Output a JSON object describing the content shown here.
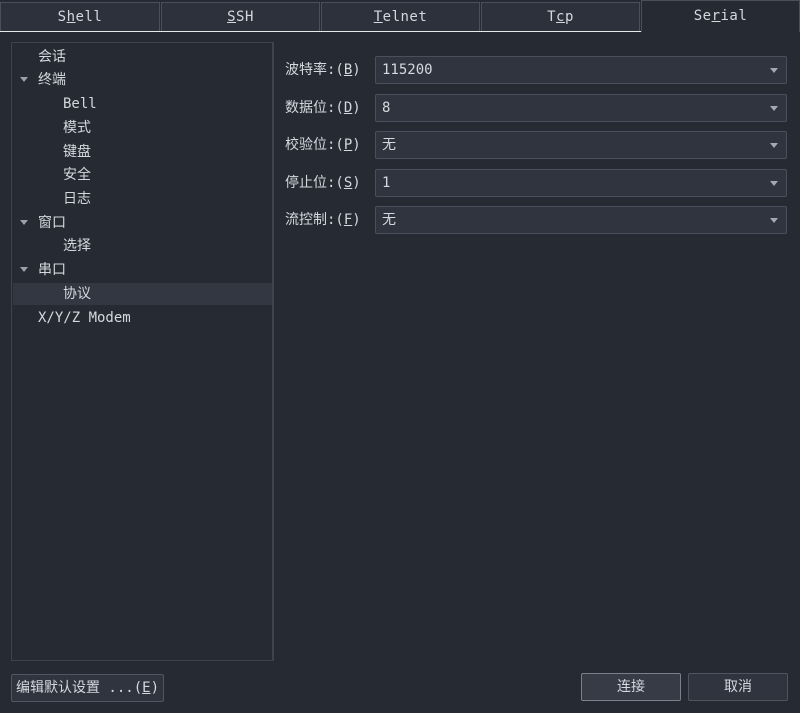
{
  "tabs": [
    {
      "pre": "S",
      "key": "h",
      "post": "ell"
    },
    {
      "pre": "",
      "key": "S",
      "post": "SH"
    },
    {
      "pre": "",
      "key": "T",
      "post": "elnet"
    },
    {
      "pre": "T",
      "key": "c",
      "post": "p"
    },
    {
      "pre": "Se",
      "key": "r",
      "post": "ial"
    }
  ],
  "tree": {
    "session": "会话",
    "terminal": "终端",
    "bell": "Bell",
    "mode": "模式",
    "keyboard": "键盘",
    "security": "安全",
    "log": "日志",
    "window": "窗口",
    "selection": "选择",
    "serial": "串口",
    "protocol": "协议",
    "modem": "X/Y/Z Modem"
  },
  "fields": {
    "baud": {
      "label": "波特率:(",
      "key": "B",
      "end": ")",
      "value": "115200"
    },
    "data": {
      "label": "数据位:(",
      "key": "D",
      "end": ")",
      "value": "8"
    },
    "parity": {
      "label": "校验位:(",
      "key": "P",
      "end": ")",
      "value": "无"
    },
    "stop": {
      "label": "停止位:(",
      "key": "S",
      "end": ")",
      "value": "1"
    },
    "flow": {
      "label": "流控制:(",
      "key": "F",
      "end": ")",
      "value": "无"
    }
  },
  "buttons": {
    "edit_default": {
      "pre": "编辑默认设置 ...(",
      "key": "E",
      "post": ")"
    },
    "connect": "连接",
    "cancel": "取消"
  }
}
